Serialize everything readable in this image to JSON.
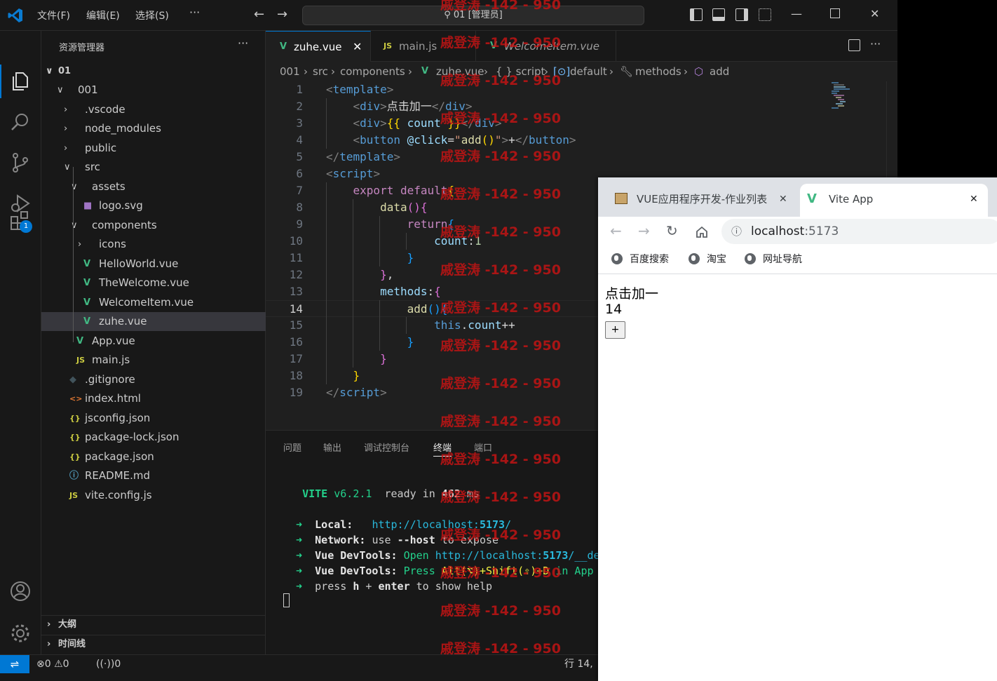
{
  "titlebar": {
    "menus": [
      "文件(F)",
      "编辑(E)",
      "选择(S)",
      "···"
    ],
    "command_center": "01 [管理员]",
    "window_buttons": [
      "minimize-icon",
      "maximize-icon",
      "close-icon"
    ]
  },
  "activitybar": {
    "items": [
      "explorer-icon",
      "search-icon",
      "source-control-icon",
      "run-debug-icon",
      "extensions-icon"
    ],
    "extensions_badge": "1",
    "bottom": [
      "account-icon",
      "gear-icon"
    ]
  },
  "sidebar": {
    "title": "资源管理器",
    "more": "···",
    "root": "01",
    "tree": [
      {
        "label": "001",
        "type": "folder-open",
        "level": 1
      },
      {
        "label": ".vscode",
        "type": "folder",
        "level": 2
      },
      {
        "label": "node_modules",
        "type": "folder",
        "level": 2
      },
      {
        "label": "public",
        "type": "folder",
        "level": 2
      },
      {
        "label": "src",
        "type": "folder-open",
        "level": 2
      },
      {
        "label": "assets",
        "type": "folder-open",
        "level": 3
      },
      {
        "label": "logo.svg",
        "type": "svg",
        "level": 4
      },
      {
        "label": "components",
        "type": "folder-open",
        "level": 3
      },
      {
        "label": "icons",
        "type": "folder",
        "level": 4
      },
      {
        "label": "HelloWorld.vue",
        "type": "vue",
        "level": 4
      },
      {
        "label": "TheWelcome.vue",
        "type": "vue",
        "level": 4
      },
      {
        "label": "WelcomeItem.vue",
        "type": "vue",
        "level": 4
      },
      {
        "label": "zuhe.vue",
        "type": "vue",
        "level": 4,
        "selected": true
      },
      {
        "label": "App.vue",
        "type": "vue",
        "level": 3
      },
      {
        "label": "main.js",
        "type": "js",
        "level": 3
      },
      {
        "label": ".gitignore",
        "type": "git",
        "level": 2
      },
      {
        "label": "index.html",
        "type": "html",
        "level": 2
      },
      {
        "label": "jsconfig.json",
        "type": "json",
        "level": 2
      },
      {
        "label": "package-lock.json",
        "type": "json",
        "level": 2
      },
      {
        "label": "package.json",
        "type": "json",
        "level": 2
      },
      {
        "label": "README.md",
        "type": "info",
        "level": 2
      },
      {
        "label": "vite.config.js",
        "type": "js",
        "level": 2
      }
    ],
    "outline": "大纲",
    "timeline": "时间线"
  },
  "tabs": [
    {
      "label": "zuhe.vue",
      "icon": "V",
      "active": true,
      "close": "✕"
    },
    {
      "label": "main.js",
      "icon": "JS",
      "active": false
    },
    {
      "label": "WelcomeItem.vue",
      "icon": "V",
      "active": false
    }
  ],
  "breadcrumb": [
    "001",
    "src",
    "components",
    "zuhe.vue",
    "{ } script",
    "default",
    "methods",
    "add"
  ],
  "editor": {
    "current_line": 14,
    "line_numbers": [
      "1",
      "2",
      "3",
      "4",
      "5",
      "6",
      "7",
      "8",
      "9",
      "10",
      "11",
      "12",
      "13",
      "14",
      "15",
      "16",
      "17",
      "18",
      "19"
    ]
  },
  "panel": {
    "tabs": [
      "问题",
      "输出",
      "调试控制台",
      "终端",
      "端口"
    ],
    "active_tab": "终端",
    "terminal": {
      "vite_name": "VITE",
      "vite_version": "v6.2.1",
      "ready_text": "ready in",
      "ready_ms": "462",
      "ms": "ms",
      "local_label": "Local:",
      "local_url_pre": "http://localhost:",
      "local_port": "5173",
      "local_url_post": "/",
      "network_label": "Network:",
      "network_use": "use",
      "network_flag": "--host",
      "network_rest": "to expose",
      "devtools_label": "Vue DevTools:",
      "devtools_open": "Open",
      "devtools_url_pre": "http://localhost:",
      "devtools_port": "5173",
      "devtools_url_post": "/__de",
      "devtools_press": "Press",
      "devtools_keys": "Alt(⌥)+Shift(⇧)+D",
      "devtools_in_app": "in App",
      "help_press": "press",
      "help_h": "h",
      "help_plus": "+",
      "help_enter": "enter",
      "help_rest": "to show help"
    }
  },
  "statusbar": {
    "errors": "0",
    "warnings": "0",
    "ports": "0",
    "position": "行 14,"
  },
  "browser": {
    "tabs": [
      {
        "label": "VUE应用程序开发-作业列表",
        "close": "✕"
      },
      {
        "label": "Vite App",
        "close": "✕",
        "active": true
      }
    ],
    "url_host": "localhost",
    "url_port": ":5173",
    "bookmarks": [
      "百度搜索",
      "淘宝",
      "网址导航"
    ],
    "page": {
      "heading": "点击加一",
      "count": "14",
      "button": "+"
    }
  },
  "watermark": "戚登涛 -142 - 950"
}
